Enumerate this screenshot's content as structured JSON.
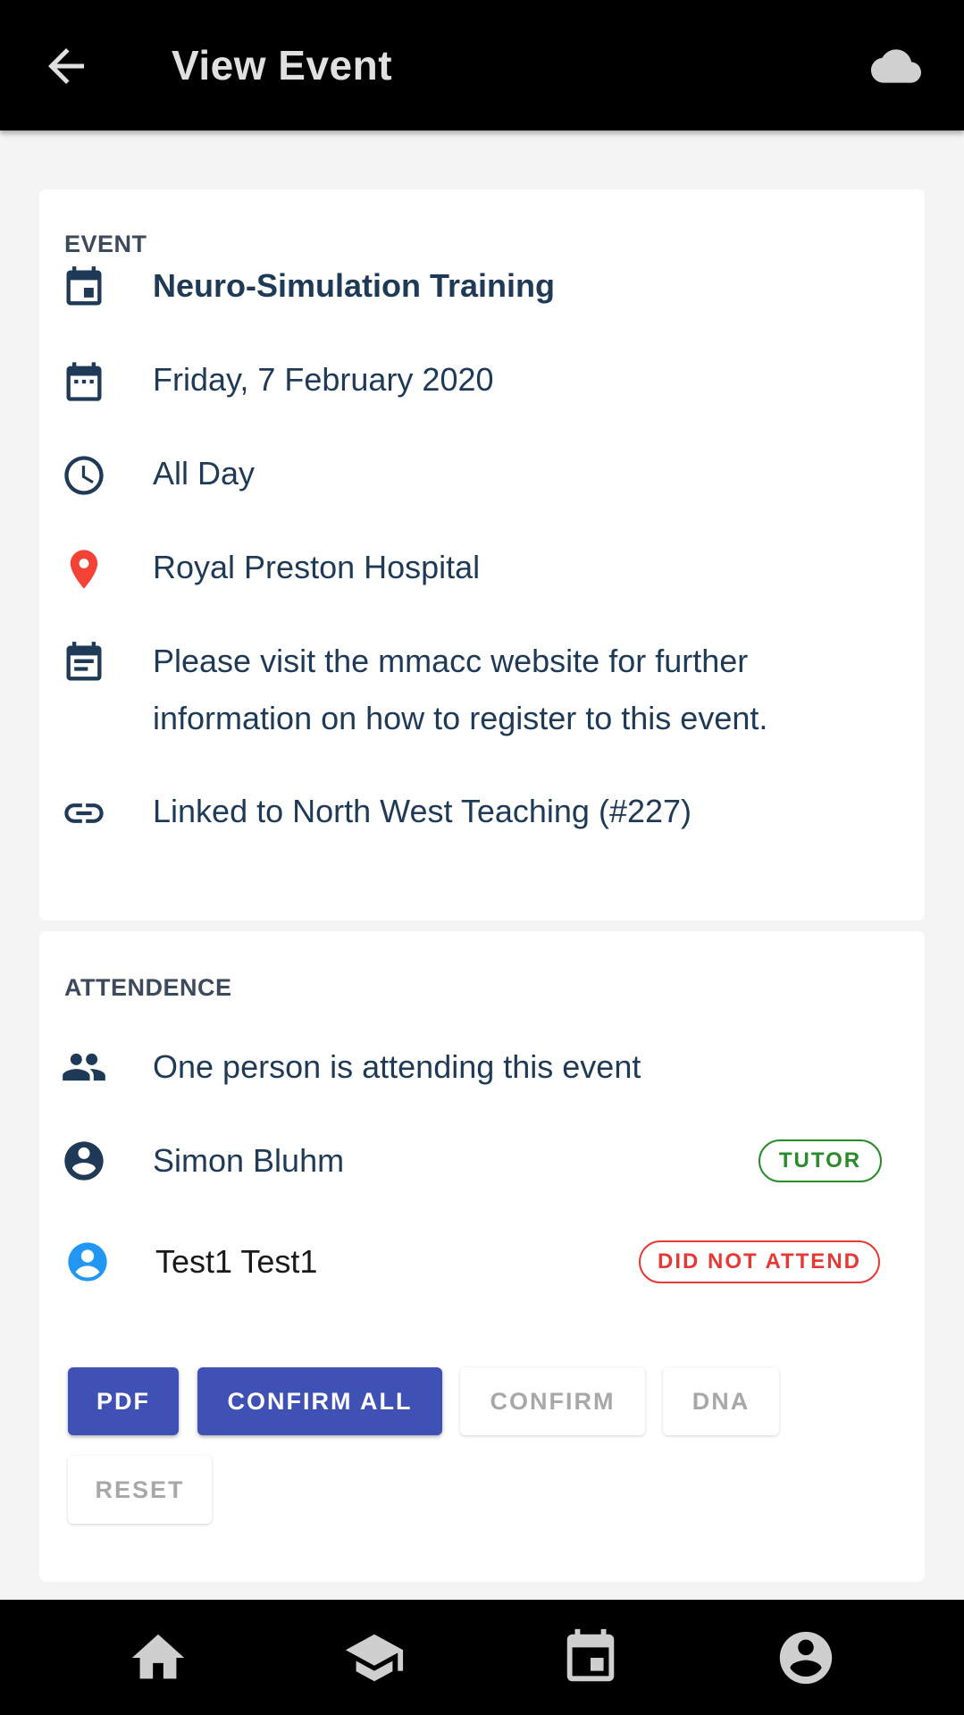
{
  "app_bar": {
    "title": "View Event",
    "back_icon": "arrow-back-icon",
    "sync_icon": "cloud-icon"
  },
  "event_section": {
    "label": "EVENT",
    "title": "Neuro-Simulation Training",
    "date": "Friday, 7 February 2020",
    "time": "All Day",
    "location": "Royal Preston Hospital",
    "description_line1": "Please visit the mmacc website for further",
    "description_line2": "information on how to register to this event.",
    "linked": "Linked to North West Teaching (#227)"
  },
  "attendance_section": {
    "label": "ATTENDENCE",
    "summary": "One person is attending this event",
    "attendees": [
      {
        "name": "Simon Bluhm",
        "status": "TUTOR"
      },
      {
        "name": "Test1 Test1",
        "status": "DID NOT ATTEND"
      }
    ],
    "buttons": {
      "pdf": "PDF",
      "confirm_all": "CONFIRM ALL",
      "confirm": "CONFIRM",
      "dna": "DNA",
      "reset": "RESET"
    }
  },
  "bottom_nav": {
    "items": [
      "home-icon",
      "school-icon",
      "event-icon",
      "account-icon"
    ]
  },
  "colors": {
    "accent": "#3f51b5",
    "text_primary": "#1f3a56",
    "tutor": "#2b8a2b",
    "did_not_attend": "#e53935",
    "location_pin": "#f44336",
    "avatar_blue": "#2196f3"
  }
}
